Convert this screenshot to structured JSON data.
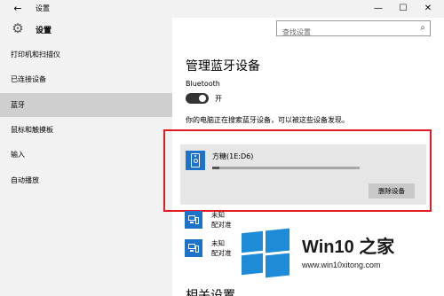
{
  "window": {
    "title": "设置",
    "back_glyph": "←",
    "minimize_glyph": "—",
    "maximize_glyph": "☐",
    "close_glyph": "✕"
  },
  "sidebar": {
    "header_title": "设置",
    "items": [
      {
        "label": "打印机和扫描仪",
        "active": false
      },
      {
        "label": "已连接设备",
        "active": false
      },
      {
        "label": "蓝牙",
        "active": true
      },
      {
        "label": "鼠标和触摸板",
        "active": false
      },
      {
        "label": "输入",
        "active": false
      },
      {
        "label": "自动播放",
        "active": false
      }
    ]
  },
  "search": {
    "placeholder": "查找设置",
    "icon_glyph": "⌕"
  },
  "main": {
    "heading": "管理蓝牙设备",
    "bluetooth_label": "Bluetooth",
    "toggle_state": "开",
    "toggle_on": true,
    "discover_text": "你的电脑正在搜索蓝牙设备，可以被这些设备发现。",
    "selected_device": {
      "name": "方糖(1E:D6)",
      "progress": 0.05,
      "remove_button": "删除设备"
    },
    "other_devices": [
      {
        "name": "未知",
        "status": "配对准"
      },
      {
        "name": "未知",
        "status": "配对准"
      }
    ],
    "related_heading": "相关设置"
  },
  "watermark": {
    "title": "Win10 之家",
    "url": "www.win10xitong.com"
  },
  "colors": {
    "accent": "#1c73c9",
    "highlight_frame": "#e21a22",
    "sidebar_bg": "#f2f2f2",
    "active_item_bg": "#cfcfcf"
  }
}
